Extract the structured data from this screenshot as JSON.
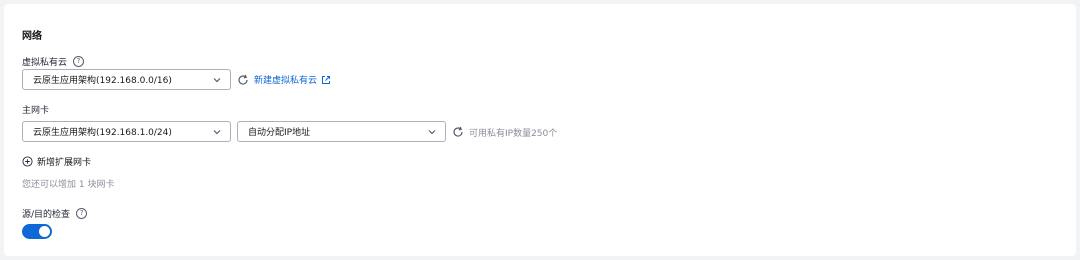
{
  "network": {
    "title": "网络",
    "vpc": {
      "label": "虚拟私有云",
      "help": "?",
      "selected": "云原生应用架构(192.168.0.0/16)",
      "create_link": "新建虚拟私有云"
    },
    "primary_nic": {
      "label": "主网卡",
      "subnet_selected": "云原生应用架构(192.168.1.0/24)",
      "ip_mode_selected": "自动分配IP地址",
      "available_ip_text": "可用私有IP数量250个"
    },
    "add_nic": {
      "label": "新增扩展网卡",
      "quota_text": "您还可以增加 1 块网卡"
    },
    "source_dest_check": {
      "label": "源/目的检查",
      "help": "?",
      "enabled": true
    }
  },
  "colors": {
    "accent": "#0e68d6",
    "border": "#adb0b8",
    "muted_text": "#8a8e99",
    "background": "#f2f3f5"
  },
  "icons": [
    "help-icon",
    "chevron-down-icon",
    "refresh-icon",
    "external-link-icon",
    "plus-circle-icon"
  ]
}
